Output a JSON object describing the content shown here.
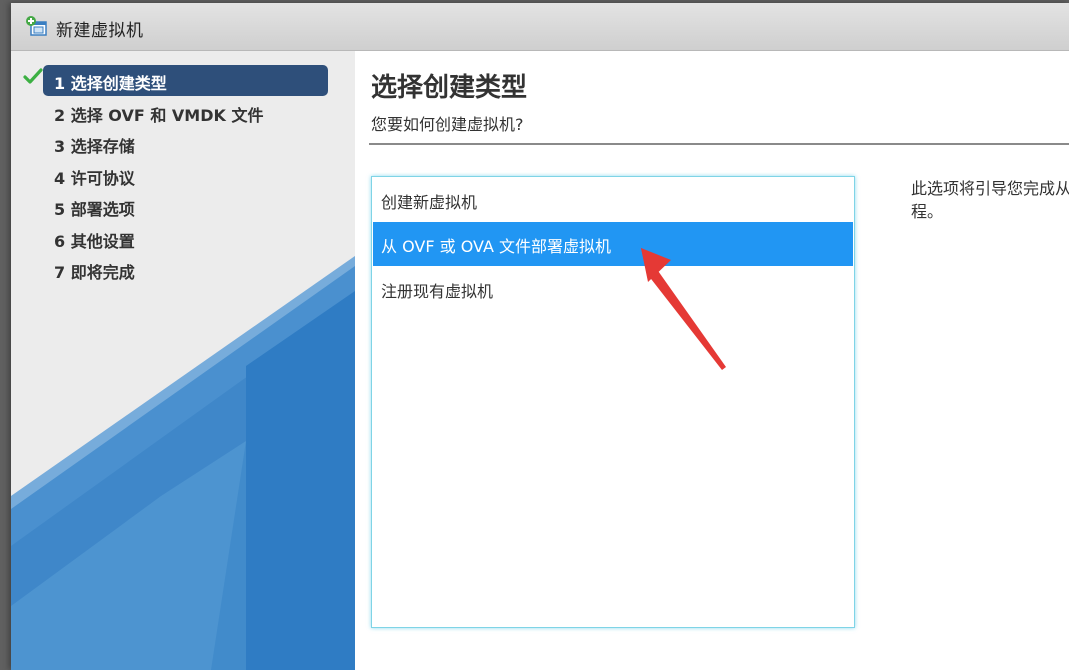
{
  "window": {
    "title": "新建虚拟机",
    "icon": "new-vm-icon"
  },
  "sidebar": {
    "steps": [
      {
        "label": "1 选择创建类型",
        "completed": true,
        "active": true
      },
      {
        "label": "2 选择 OVF 和 VMDK 文件",
        "completed": false,
        "active": false
      },
      {
        "label": "3 选择存储",
        "completed": false,
        "active": false
      },
      {
        "label": "4 许可协议",
        "completed": false,
        "active": false
      },
      {
        "label": "5 部署选项",
        "completed": false,
        "active": false
      },
      {
        "label": "6 其他设置",
        "completed": false,
        "active": false
      },
      {
        "label": "7 即将完成",
        "completed": false,
        "active": false
      }
    ],
    "active_color": "#2e4f7a",
    "check_color": "#3cb043"
  },
  "main": {
    "title": "选择创建类型",
    "subtitle": "您要如何创建虚拟机?",
    "options": [
      {
        "label": "创建新虚拟机",
        "selected": false
      },
      {
        "label": "从 OVF 或 OVA 文件部署虚拟机",
        "selected": true
      },
      {
        "label": "注册现有虚拟机",
        "selected": false
      }
    ],
    "selected_color": "#2196f3",
    "description": "此选项将引导您完成从\n程。"
  }
}
